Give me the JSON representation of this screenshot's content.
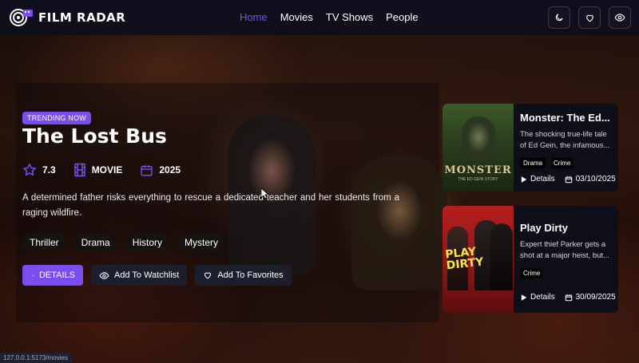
{
  "header": {
    "brand": "FILM RADAR",
    "nav": [
      {
        "label": "Home",
        "active": true
      },
      {
        "label": "Movies",
        "active": false
      },
      {
        "label": "TV Shows",
        "active": false
      },
      {
        "label": "People",
        "active": false
      }
    ],
    "icons": [
      "moon-icon",
      "heart-icon",
      "eye-icon"
    ]
  },
  "hero": {
    "badge": "TRENDING NOW",
    "title": "The Lost Bus",
    "rating": "7.3",
    "type": "MOVIE",
    "year": "2025",
    "description": "A determined father risks everything to rescue a dedicated teacher and her students from a raging wildfire.",
    "genres": [
      "Thriller",
      "Drama",
      "History",
      "Mystery"
    ],
    "actions": {
      "details": "DETAILS",
      "watchlist": "Add To Watchlist",
      "favorites": "Add To Favorites"
    }
  },
  "side_cards": [
    {
      "title": "Monster: The Ed Gein Story",
      "title_display": "Monster: The Ed...",
      "description": "The shocking true-life tale of Ed Gein, the infamous...",
      "tags": [
        "Drama",
        "Crime"
      ],
      "details_label": "Details",
      "date": "03/10/2025",
      "poster_text": "MONSTER",
      "poster_subtext": "THE ED GEIN STORY"
    },
    {
      "title": "Play Dirty",
      "title_display": "Play Dirty",
      "description": "Expert thief Parker gets a shot at a major heist, but...",
      "tags": [
        "Crime"
      ],
      "details_label": "Details",
      "date": "30/09/2025",
      "poster_text_1": "PLAY",
      "poster_text_2": "DIRTY"
    }
  ],
  "status_url": "127.0.0.1:5173/movies",
  "colors": {
    "accent": "#7a4df0",
    "header_bg": "#0e0f1a"
  }
}
